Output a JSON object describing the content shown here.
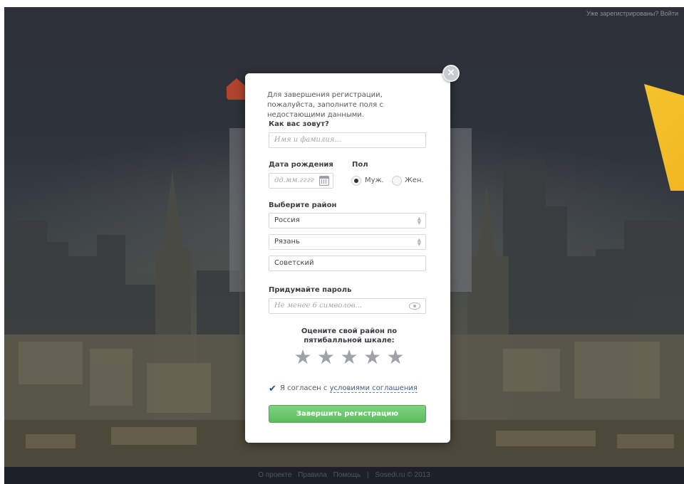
{
  "header": {
    "login_link": "Уже зарегистрированы? Войти"
  },
  "modal": {
    "close_glyph": "×",
    "intro_text": "Для завершения регистрации, пожалуйста, заполните поля с недостающими данными.",
    "name": {
      "label": "Как вас зовут?",
      "placeholder": "Имя и фамилия..."
    },
    "birthdate": {
      "label": "Дата рождения",
      "placeholder": "дд.мм.гггг"
    },
    "gender": {
      "label": "Пол",
      "options": [
        {
          "label": "Муж.",
          "checked": true
        },
        {
          "label": "Жен.",
          "checked": false
        }
      ]
    },
    "district": {
      "label": "Выберите район",
      "country": "Россия",
      "city": "Рязань",
      "district": "Советский"
    },
    "password": {
      "label": "Придумайте пароль",
      "placeholder": "Не менее 6 символов..."
    },
    "rating": {
      "title": "Оцените свой район по пятибалльной шкале:",
      "stars": 5,
      "value": 0
    },
    "agreement": {
      "checked": true,
      "prefix": "Я согласен с",
      "link": "условиями соглашения"
    },
    "submit_label": "Завершить регистрацию"
  },
  "footer": {
    "links": [
      "О проекте",
      "Правила",
      "Помощь"
    ],
    "separator": "|",
    "copyright": "Sosedi.ru © 2013"
  },
  "colors": {
    "accent_green": "#5dbb5f",
    "brand_yellow": "#f4c12a",
    "link_blue": "#3f5b8c"
  }
}
